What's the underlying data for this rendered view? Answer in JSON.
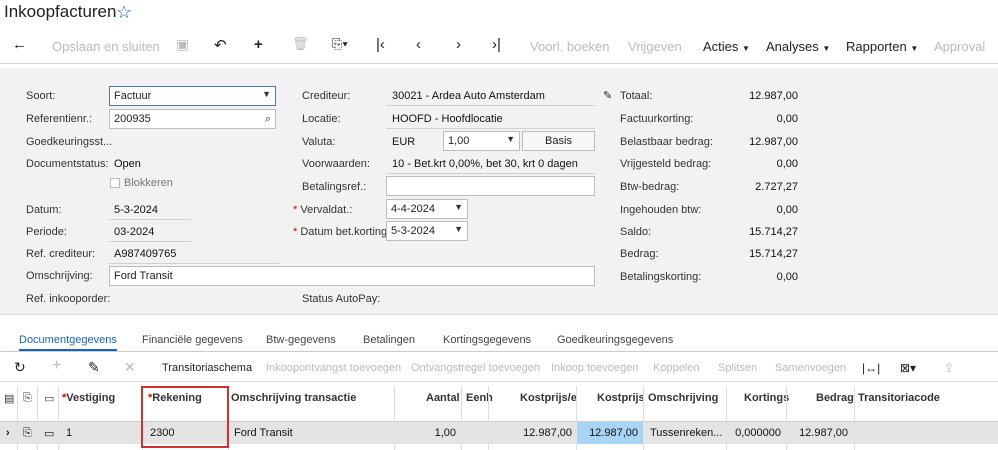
{
  "header": {
    "title": "Inkoopfacturen",
    "favorite_icon": "star-outline-icon"
  },
  "toolbar": {
    "back_icon": "arrow-left-icon",
    "save_close": "Opslaan en sluiten",
    "save_icon": "floppy-disk-icon",
    "undo_icon": "undo-icon",
    "add_icon": "plus-icon",
    "delete_icon": "trash-icon",
    "copy_icon": "clipboard-paste-icon",
    "first_icon": "first-record-icon",
    "prev_icon": "previous-record-icon",
    "next_icon": "next-record-icon",
    "last_icon": "last-record-icon",
    "post": "Voorl. boeken",
    "release": "Vrijgeven",
    "actions": "Acties",
    "analyses": "Analyses",
    "reports": "Rapporten",
    "approval": "Approval"
  },
  "form": {
    "soort_label": "Soort:",
    "soort_value": "Factuur",
    "ref_label": "Referentienr.:",
    "ref_value": "200935",
    "goedk_label": "Goedkeuringsst...",
    "docstatus_label": "Documentstatus:",
    "docstatus_value": "Open",
    "blokkeren_label": "Blokkeren",
    "datum_label": "Datum:",
    "datum_value": "5-3-2024",
    "periode_label": "Periode:",
    "periode_value": "03-2024",
    "refcred_label": "Ref. crediteur:",
    "refcred_value": "A987409765",
    "omschr_label": "Omschrijving:",
    "omschr_value": "Ford Transit",
    "refinkoop_label": "Ref. inkooporder:",
    "crediteur_label": "Crediteur:",
    "crediteur_value": "30021 - Ardea Auto Amsterdam",
    "locatie_label": "Locatie:",
    "locatie_value": "HOOFD - Hoofdlocatie",
    "valuta_label": "Valuta:",
    "valuta_value": "EUR",
    "rate_value": "1,00",
    "basis_label": "Basis",
    "voorw_label": "Voorwaarden:",
    "voorw_value": "10 - Bet.krt 0,00%, bet 30, krt 0 dagen",
    "betref_label": "Betalingsref.:",
    "vervaldat_label": "Vervaldat.:",
    "vervaldat_value": "4-4-2024",
    "datumbet_label": "Datum bet.korting:",
    "datumbet_value": "5-3-2024",
    "autopay_label": "Status AutoPay:",
    "totaal_label": "Totaal:",
    "totaal_value": "12.987,00",
    "factkort_label": "Factuurkorting:",
    "factkort_value": "0,00",
    "belastbaar_label": "Belastbaar bedrag:",
    "belastbaar_value": "12.987,00",
    "vrijgesteld_label": "Vrijgesteld bedrag:",
    "vrijgesteld_value": "0,00",
    "btw_label": "Btw-bedrag:",
    "btw_value": "2.727,27",
    "ingehouden_label": "Ingehouden btw:",
    "ingehouden_value": "0,00",
    "saldo_label": "Saldo:",
    "saldo_value": "15.714,27",
    "bedrag_label": "Bedrag:",
    "bedrag_value": "15.714,27",
    "betkort_label": "Betalingskorting:",
    "betkort_value": "0,00"
  },
  "tabs": [
    "Documentgegevens",
    "Financiële gegevens",
    "Btw-gegevens",
    "Betalingen",
    "Kortingsgegevens",
    "Goedkeuringsgegevens"
  ],
  "grid_toolbar": {
    "transitoria": "Transitoriaschema",
    "inkoopontvangst": "Inkoopontvangst toevoegen",
    "ontvangstregel": "Ontvangstregel toevoegen",
    "inkoop": "Inkoop toevoegen",
    "koppelen": "Koppelen",
    "splitsen": "Splitsen",
    "samenvoegen": "Samenvoegen"
  },
  "grid": {
    "headers": {
      "vestiging": "Vestiging",
      "rekening": "Rekening",
      "omschr_trans": "Omschrijving transactie",
      "aantal": "Aantal",
      "eenh": "Eenh",
      "kostprijs_e": "Kostprijs/e",
      "kostprijs": "Kostprijs",
      "omschrijving": "Omschrijving",
      "korting": "Kortings",
      "bedrag": "Bedrag",
      "transitoriacode": "Transitoriacode"
    },
    "row": {
      "vestiging": "1",
      "rekening": "2300",
      "omschr_trans": "Ford Transit",
      "aantal": "1,00",
      "kostprijs_e": "12.987,00",
      "kostprijs": "12.987,00",
      "omschrijving": "Tussenreken...",
      "korting": "0,000000",
      "bedrag": "12.987,00"
    }
  },
  "colors": {
    "accent": "#1565c0",
    "highlight_box": "#d32f2f",
    "selected_cell": "#a8d4f5"
  }
}
